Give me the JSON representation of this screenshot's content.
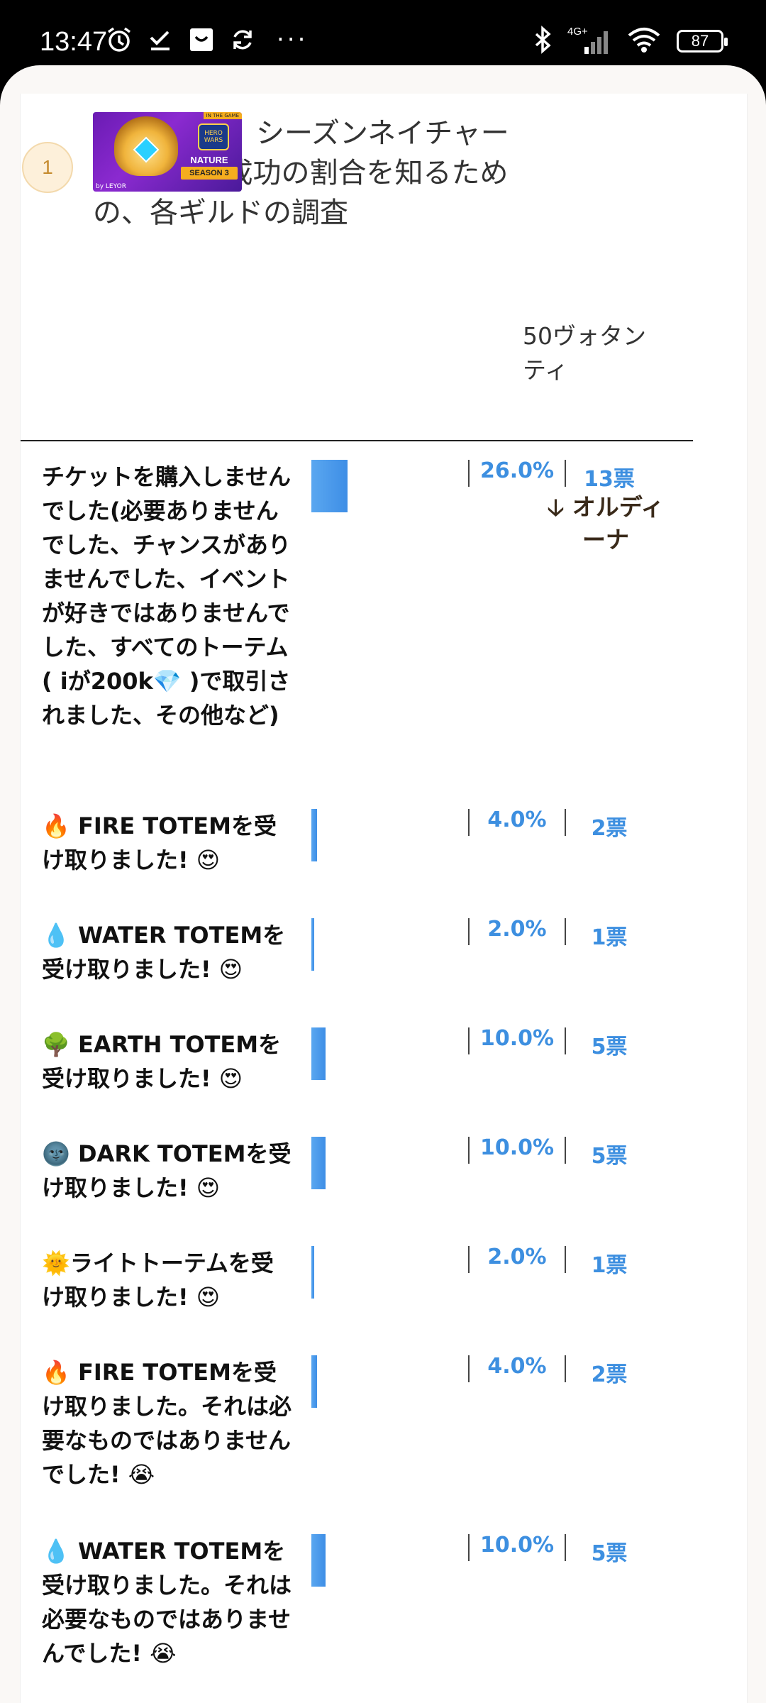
{
  "status_bar": {
    "time": "13:47",
    "network": "4G+",
    "battery": "87",
    "icons_left": [
      "alarm-icon",
      "checkmark-icon",
      "app-icon",
      "sync-icon"
    ],
    "overflow": "···"
  },
  "poll": {
    "number": "1",
    "thumbnail": {
      "corner": "IN THE GAME",
      "logo": "HERO WARS",
      "line1": "NATURE",
      "line2": "SEASON 3",
      "by": "by LEYOR"
    },
    "title": "シーズンネイチャー3の承認と成功の割合を知るための、各ギルドの調査",
    "column_header": "50ヴォタンティ",
    "sort_header": "🡣 オルディーナ",
    "options": [
      {
        "label": "チケットを購入しませんでした(必要ありませんでした、チャンスがありませんでした、イベントが好きではありませんでした、すべてのトーテム( iが200k💎 )で取引されました、その他など)",
        "percent": "26.0%",
        "votes": "13票",
        "share": 0.26
      },
      {
        "label": "🔥 FIRE TOTEMを受け取りました! 😍",
        "percent": "4.0%",
        "votes": "2票",
        "share": 0.04
      },
      {
        "label": "💧 WATER TOTEMを受け取りました! 😍",
        "percent": "2.0%",
        "votes": "1票",
        "share": 0.02
      },
      {
        "label": "🌳 EARTH TOTEMを受け取りました! 😍",
        "percent": "10.0%",
        "votes": "5票",
        "share": 0.1
      },
      {
        "label": "🌚 DARK TOTEMを受け取りました! 😍",
        "percent": "10.0%",
        "votes": "5票",
        "share": 0.1
      },
      {
        "label": "🌞ライトトーテムを受け取りました! 😍",
        "percent": "2.0%",
        "votes": "1票",
        "share": 0.02
      },
      {
        "label": "🔥 FIRE TOTEMを受け取りました。それは必要なものではありませんでした! 😭",
        "percent": "4.0%",
        "votes": "2票",
        "share": 0.04
      },
      {
        "label": "💧 WATER TOTEMを受け取りました。それは必要なものではありませんでした! 😭",
        "percent": "10.0%",
        "votes": "5票",
        "share": 0.1
      }
    ]
  }
}
